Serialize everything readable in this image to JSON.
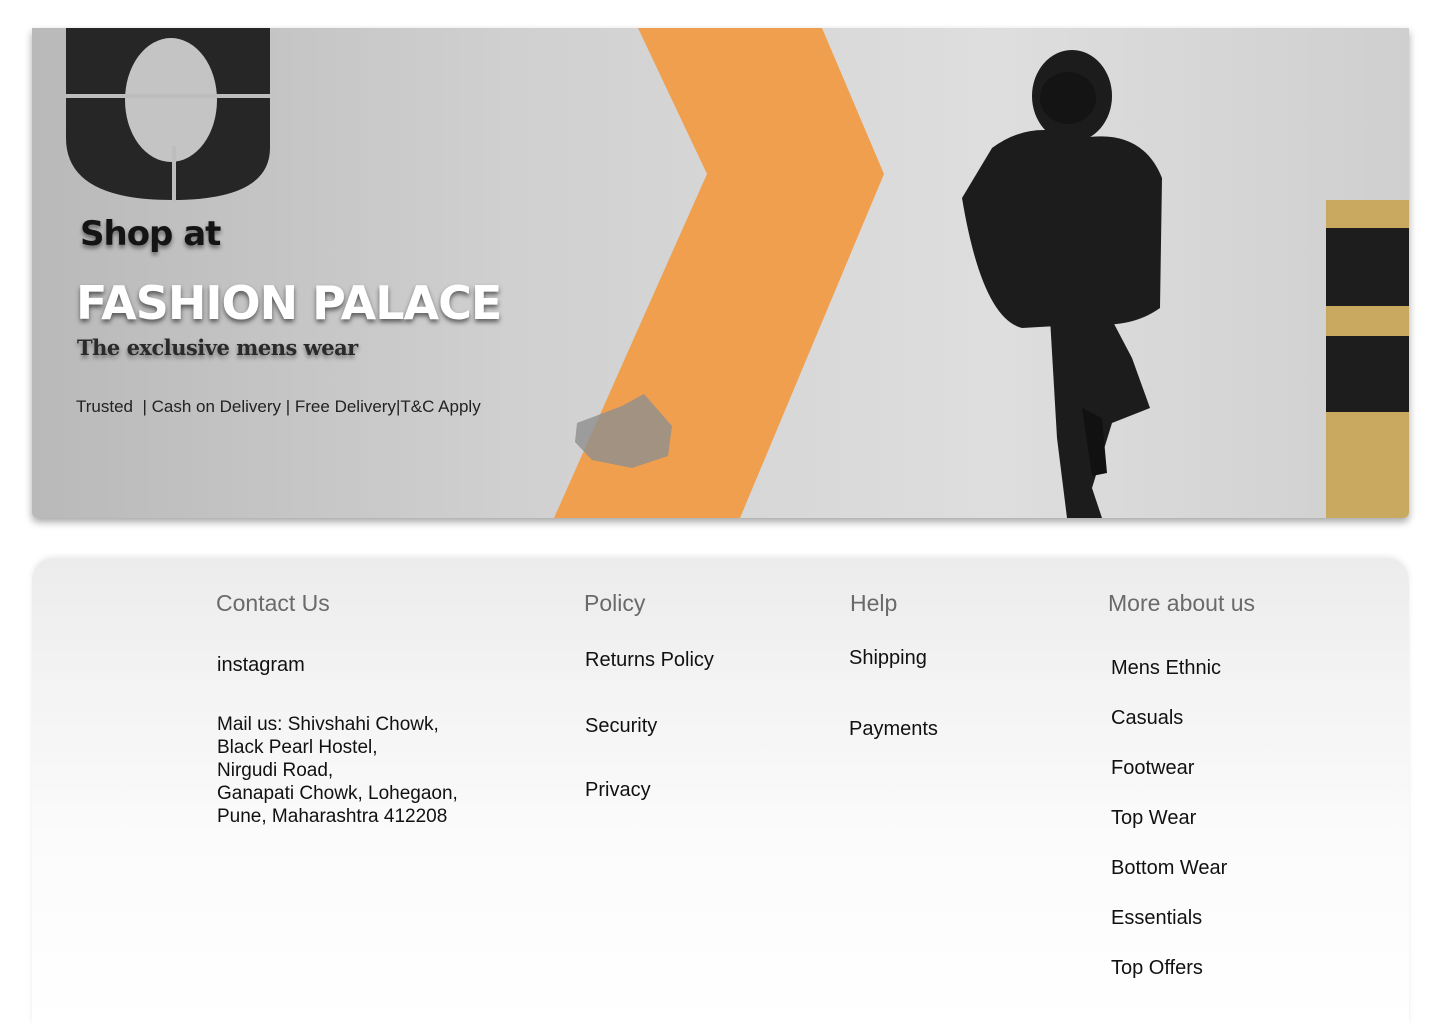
{
  "hero": {
    "shop_at": "Shop at",
    "brand": "FASHION PALACE",
    "tagline": "The exclusive mens wear",
    "features": "Trusted  | Cash on Delivery | Free Delivery|T&C Apply",
    "colors": {
      "stripe": "#f0a04f",
      "wall": "#d4d4d4",
      "jacket": "#1c1c1c"
    }
  },
  "footer": {
    "contact": {
      "heading": "Contact Us",
      "instagram": "instagram",
      "address_lines": [
        "Mail us: Shivshahi Chowk,",
        "Black Pearl Hostel,",
        "Nirgudi Road,",
        "Ganapati Chowk, Lohegaon,",
        "Pune, Maharashtra 412208"
      ]
    },
    "policy": {
      "heading": "Policy",
      "items": [
        "Returns Policy",
        "Security",
        "Privacy"
      ]
    },
    "help": {
      "heading": "Help",
      "items": [
        "Shipping",
        "Payments"
      ]
    },
    "more": {
      "heading": "More about us",
      "items": [
        "Mens Ethnic",
        "Casuals",
        "Footwear",
        "Top Wear",
        "Bottom Wear",
        "Essentials",
        "Top Offers"
      ]
    }
  }
}
